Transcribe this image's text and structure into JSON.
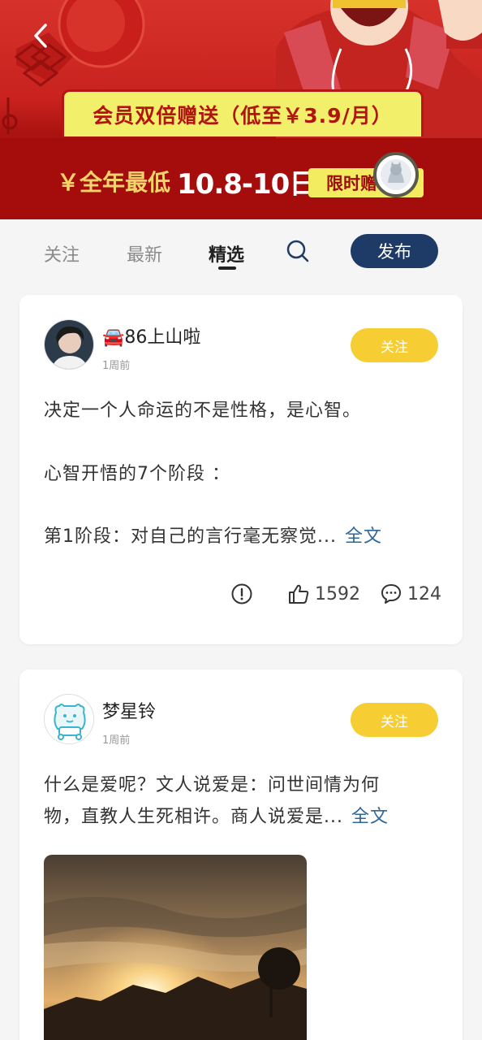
{
  "banner": {
    "promo_title": "会员双倍赠送（低至￥3.9/月）",
    "price_label": "￥全年最低",
    "price_value": "10.8-10日",
    "limit_badge": "限时赠"
  },
  "icons": {
    "back": "chevron-left-icon",
    "search": "search-icon",
    "alert": "exclamation-circle-icon",
    "like": "thumbs-up-icon",
    "comment": "comment-icon"
  },
  "tabs": [
    {
      "label": "关注"
    },
    {
      "label": "最新"
    },
    {
      "label": "精选",
      "active": true
    }
  ],
  "publish_label": "发布",
  "posts": [
    {
      "username": "🚘86上山啦",
      "time": "1周前",
      "follow_label": "关注",
      "lines": [
        "决定一个人命运的不是性格，是心智。",
        "心智开悟的7个阶段 ："
      ],
      "last_line": "第1阶段：对自己的言行毫无察觉...",
      "more_label": "全文",
      "likes": "1592",
      "comments": "124"
    },
    {
      "username": "梦星铃",
      "time": "1周前",
      "follow_label": "关注",
      "line1": "什么是爱呢？文人说爱是：问世间情为何",
      "line2": "物，直教人生死相许。商人说爱是...",
      "more_label": "全文"
    }
  ],
  "colors": {
    "banner_red": "#c9221f",
    "banner_dark": "#a40d0c",
    "promo_yellow": "#f2f06a",
    "publish_navy": "#1e3a66",
    "follow_yellow": "#f7cd34",
    "link_blue": "#2f6797"
  }
}
